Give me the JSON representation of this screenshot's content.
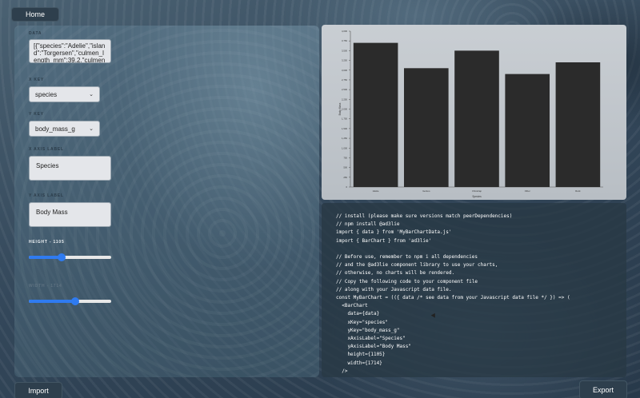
{
  "nav": {
    "home_label": "Home",
    "import_label": "Import",
    "export_label": "Export"
  },
  "form": {
    "data_label": "DATA",
    "data_value": "[{\"species\":\"Adelie\",\"island\":\"Torgersen\",\"culmen_length_mm\":39.2,\"culmen",
    "xkey_label": "X KEY",
    "xkey_value": "species",
    "ykey_label": "Y KEY",
    "ykey_value": "body_mass_g",
    "xaxis_label": "X AXIS LABEL",
    "xaxis_value": "Species",
    "yaxis_label": "Y AXIS LABEL",
    "yaxis_value": "Body Mass",
    "height_label": "HEIGHT - 1105",
    "height_level": 0.4,
    "width_label": "WIDTH - 1714",
    "width_level": 0.56,
    "accent_color": "#2f7bf0"
  },
  "chart_data": {
    "type": "bar",
    "categories": [
      "Adelie",
      "Gentoo",
      "Chinstrap",
      "Other",
      "Rock"
    ],
    "values": [
      3700,
      3050,
      3500,
      2900,
      3200
    ],
    "yticks": [
      0,
      250,
      500,
      750,
      1000,
      1250,
      1500,
      1750,
      2000,
      2250,
      2500,
      2750,
      3000,
      3250,
      3500,
      3750,
      4000
    ],
    "ylim": [
      0,
      4000
    ],
    "xlabel": "Species",
    "ylabel": "Body Mass",
    "bar_color": "#2b2b2b",
    "grid": false
  },
  "code": [
    "// install (please make sure versions match peerDependencies)",
    "// npm install @ad3lie",
    "import { data } from 'MyBarChartData.js'",
    "import { BarChart } from 'ad3lie'",
    "",
    "// Before use, remember to npm i all dependencies",
    "// and the @ad3lie component library to use your charts,",
    "// otherwise, no charts will be rendered.",
    "// Copy the following code to your component file",
    "// along with your Javascript data file.",
    "const MyBarChart = (({ data /* see data from your Javascript data file */ }) => (",
    "  <BarChart",
    "    data={data}",
    "    xKey=\"species\"",
    "    yKey=\"body_mass_g\"",
    "    xAxisLabel=\"Species\"",
    "    yAxisLabel=\"Body Mass\"",
    "    height={1105}",
    "    width={1714}",
    "  />"
  ]
}
